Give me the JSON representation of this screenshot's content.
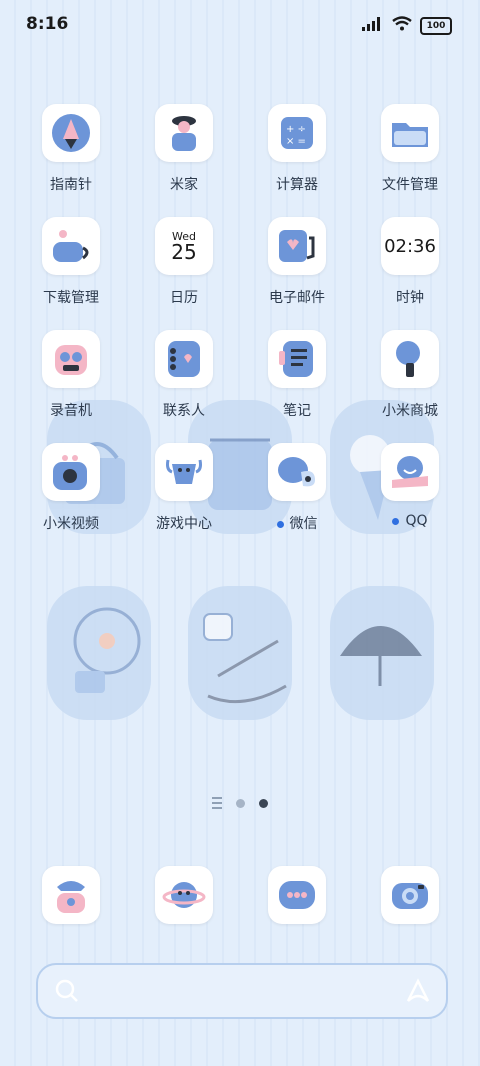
{
  "status": {
    "time": "8:16",
    "battery": "100"
  },
  "apps": [
    {
      "label": "指南针",
      "icon": "compass-icon"
    },
    {
      "label": "米家",
      "icon": "mijia-icon"
    },
    {
      "label": "计算器",
      "icon": "calculator-icon"
    },
    {
      "label": "文件管理",
      "icon": "folder-icon"
    },
    {
      "label": "下载管理",
      "icon": "download-icon"
    },
    {
      "label": "日历",
      "icon": "calendar-icon",
      "day": "Wed",
      "date": "25"
    },
    {
      "label": "电子邮件",
      "icon": "email-icon"
    },
    {
      "label": "时钟",
      "icon": "clock-icon",
      "time": "02:36"
    },
    {
      "label": "录音机",
      "icon": "recorder-icon"
    },
    {
      "label": "联系人",
      "icon": "contacts-icon"
    },
    {
      "label": "笔记",
      "icon": "notes-icon"
    },
    {
      "label": "小米商城",
      "icon": "mall-icon"
    },
    {
      "label": "小米视频",
      "icon": "video-icon"
    },
    {
      "label": "游戏中心",
      "icon": "game-center-icon"
    },
    {
      "label": "微信",
      "icon": "wechat-icon",
      "badge": true
    },
    {
      "label": "QQ",
      "icon": "qq-icon",
      "badge": true
    }
  ],
  "dock": [
    {
      "icon": "phone-icon"
    },
    {
      "icon": "browser-icon"
    },
    {
      "icon": "messages-icon"
    },
    {
      "icon": "camera-icon"
    }
  ],
  "colors": {
    "accent": "#2f6fe0",
    "icon_blue": "#6d95d8",
    "icon_pink": "#f4b6c6"
  }
}
